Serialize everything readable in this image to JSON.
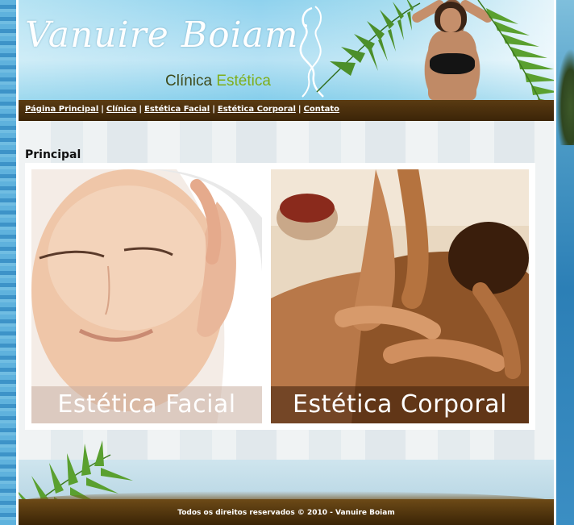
{
  "header": {
    "brand_name": "Vanuire Boiam",
    "brand_sub_1": "Clínica ",
    "brand_sub_2": "Estética"
  },
  "nav": {
    "items": [
      "Página Principal",
      "Clínica",
      "Estética Facial",
      "Estética Corporal",
      "Contato"
    ],
    "separator": "|"
  },
  "main": {
    "heading": "Principal",
    "tiles": [
      {
        "label": "Estética Facial"
      },
      {
        "label": "Estética Corporal"
      }
    ]
  },
  "footer": {
    "text": "Todos os direitos reservados © 2010 - Vanuire Boiam"
  },
  "colors": {
    "nav_bg": "#4a2f0d",
    "brand_sub_dark": "#3e4b1c",
    "brand_sub_accent": "#7fae1a"
  }
}
